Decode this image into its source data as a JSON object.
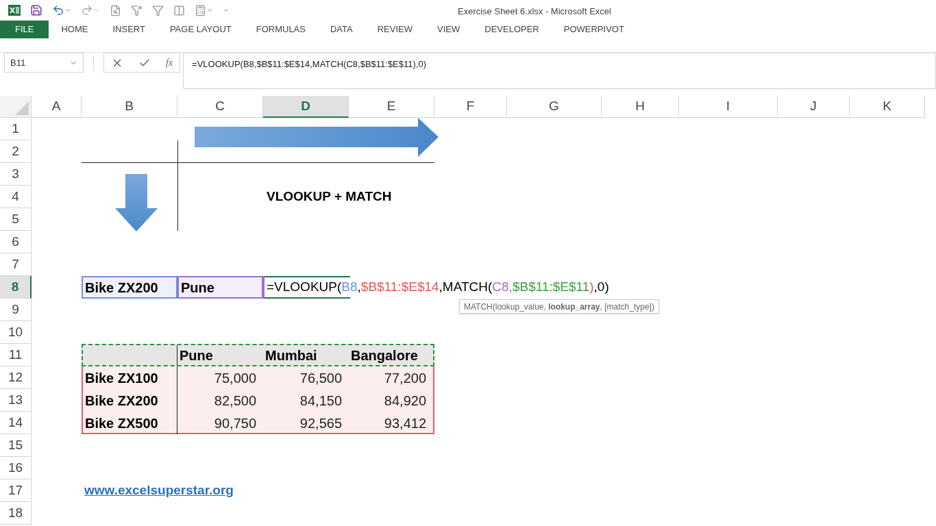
{
  "window": {
    "title": "Exercise Sheet 6.xlsx - Microsoft Excel"
  },
  "ribbon_tabs": [
    {
      "label": "FILE",
      "kind": "file"
    },
    {
      "label": "HOME",
      "kind": "tab"
    },
    {
      "label": "INSERT",
      "kind": "tab"
    },
    {
      "label": "PAGE LAYOUT",
      "kind": "tab"
    },
    {
      "label": "FORMULAS",
      "kind": "tab"
    },
    {
      "label": "DATA",
      "kind": "tab"
    },
    {
      "label": "REVIEW",
      "kind": "tab"
    },
    {
      "label": "VIEW",
      "kind": "tab"
    },
    {
      "label": "DEVELOPER",
      "kind": "tab"
    },
    {
      "label": "POWERPIVOT",
      "kind": "tab"
    }
  ],
  "formula_bar": {
    "name_box": "B11",
    "function_label": "fx",
    "formula": "=VLOOKUP(B8,$B$11:$E$14,MATCH(C8,$B$11:$E$11),0)"
  },
  "columns": [
    {
      "label": "A",
      "selected": false
    },
    {
      "label": "B",
      "selected": false
    },
    {
      "label": "C",
      "selected": false
    },
    {
      "label": "D",
      "selected": true
    },
    {
      "label": "E",
      "selected": false
    },
    {
      "label": "F",
      "selected": false
    },
    {
      "label": "G",
      "selected": false
    },
    {
      "label": "H",
      "selected": false
    },
    {
      "label": "I",
      "selected": false
    },
    {
      "label": "J",
      "selected": false
    },
    {
      "label": "K",
      "selected": false
    }
  ],
  "rows": [
    {
      "label": "1",
      "selected": false
    },
    {
      "label": "2",
      "selected": false
    },
    {
      "label": "3",
      "selected": false
    },
    {
      "label": "4",
      "selected": false
    },
    {
      "label": "5",
      "selected": false
    },
    {
      "label": "6",
      "selected": false
    },
    {
      "label": "7",
      "selected": false
    },
    {
      "label": "8",
      "selected": true
    },
    {
      "label": "9",
      "selected": false
    },
    {
      "label": "10",
      "selected": false
    },
    {
      "label": "11",
      "selected": false
    },
    {
      "label": "12",
      "selected": false
    },
    {
      "label": "13",
      "selected": false
    },
    {
      "label": "14",
      "selected": false
    },
    {
      "label": "15",
      "selected": false
    },
    {
      "label": "16",
      "selected": false
    },
    {
      "label": "17",
      "selected": false
    },
    {
      "label": "18",
      "selected": false
    }
  ],
  "sheet": {
    "title": "VLOOKUP + MATCH",
    "lookup": {
      "product": "Bike ZX200",
      "city": "Pune"
    },
    "formula_parts": [
      {
        "text": "=VLOOKUP(",
        "color": "#000000"
      },
      {
        "text": "B8",
        "color": "#6f8fe6"
      },
      {
        "text": ",",
        "color": "#000000"
      },
      {
        "text": "$B$11:$E$14",
        "color": "#e05a5a"
      },
      {
        "text": ",MATCH(",
        "color": "#000000"
      },
      {
        "text": "C8,",
        "color": "#9a6fd0"
      },
      {
        "text": "$B$11:$E$11",
        "color": "#3aa13a"
      },
      {
        "text": ")",
        "color": "#e05a5a"
      },
      {
        "text": ",0)",
        "color": "#000000"
      }
    ],
    "tooltip": "MATCH(lookup_value, **lookup_array**, [match_type])",
    "table": {
      "header": [
        "Pune",
        "Mumbai",
        "Bangalore"
      ],
      "rows": [
        {
          "label": "Bike ZX100",
          "values": [
            "75,000",
            "76,500",
            "77,200"
          ]
        },
        {
          "label": "Bike ZX200",
          "values": [
            "82,500",
            "84,150",
            "84,920"
          ]
        },
        {
          "label": "Bike ZX500",
          "values": [
            "90,750",
            "92,565",
            "93,412"
          ]
        }
      ]
    },
    "link": "www.excelsuperstar.org"
  }
}
